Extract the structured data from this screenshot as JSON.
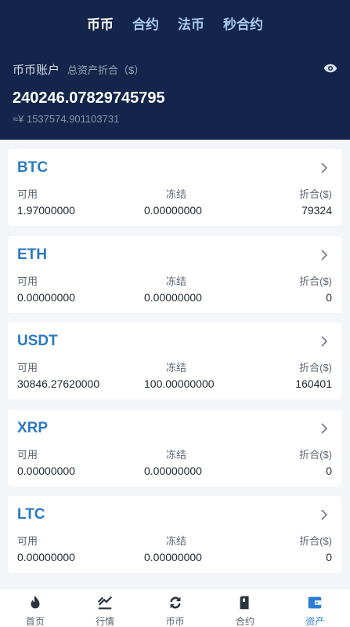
{
  "tabs": [
    {
      "label": "币币",
      "active": true
    },
    {
      "label": "合约",
      "active": false
    },
    {
      "label": "法币",
      "active": false
    },
    {
      "label": "秒合约",
      "active": false
    }
  ],
  "account": {
    "title": "币币账户",
    "subtitle": "总资产折合（$）",
    "total": "240246.07829745795",
    "cny": "≈¥ 1537574.901103731"
  },
  "labels": {
    "available": "可用",
    "frozen": "冻结",
    "converted": "折合($)"
  },
  "assets": [
    {
      "coin": "BTC",
      "available": "1.97000000",
      "frozen": "0.00000000",
      "converted": "79324"
    },
    {
      "coin": "ETH",
      "available": "0.00000000",
      "frozen": "0.00000000",
      "converted": "0"
    },
    {
      "coin": "USDT",
      "available": "30846.27620000",
      "frozen": "100.00000000",
      "converted": "160401"
    },
    {
      "coin": "XRP",
      "available": "0.00000000",
      "frozen": "0.00000000",
      "converted": "0"
    },
    {
      "coin": "LTC",
      "available": "0.00000000",
      "frozen": "0.00000000",
      "converted": "0"
    }
  ],
  "nav": [
    {
      "label": "首页",
      "icon": "flame-icon",
      "active": false
    },
    {
      "label": "行情",
      "icon": "chart-icon",
      "active": false
    },
    {
      "label": "币币",
      "icon": "exchange-icon",
      "active": false
    },
    {
      "label": "合约",
      "icon": "wallet-icon",
      "active": false
    },
    {
      "label": "资产",
      "icon": "assets-icon",
      "active": true
    }
  ],
  "colors": {
    "header_bg": "#13254a",
    "accent": "#2b7ed6",
    "coin_text": "#2a7ac0"
  }
}
